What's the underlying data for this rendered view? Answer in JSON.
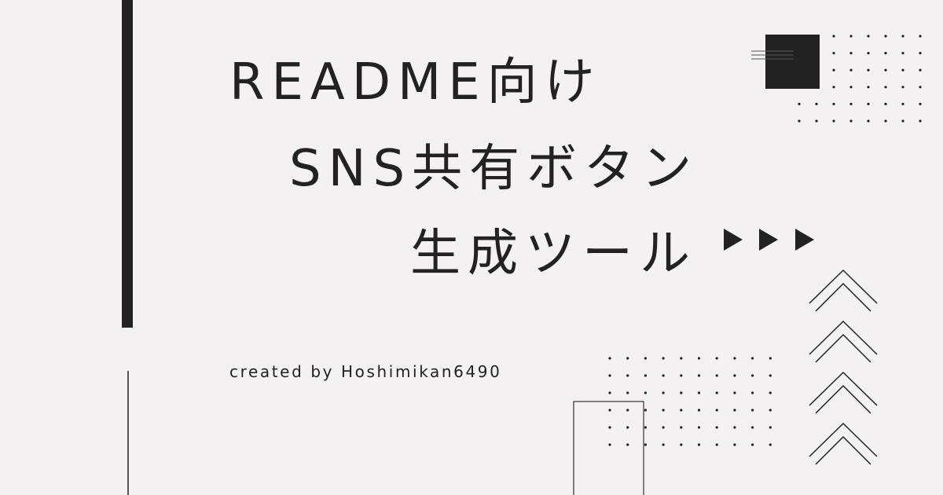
{
  "title": {
    "line1": "README向け",
    "line2": "SNS共有ボタン",
    "line3": "生成ツール"
  },
  "credit": "created by Hoshimikan6490",
  "icons": {
    "arrows": "play-triangle-icon",
    "chevrons": "chevron-up-icon"
  },
  "colors": {
    "background": "#f3f1f1",
    "ink": "#222222"
  }
}
